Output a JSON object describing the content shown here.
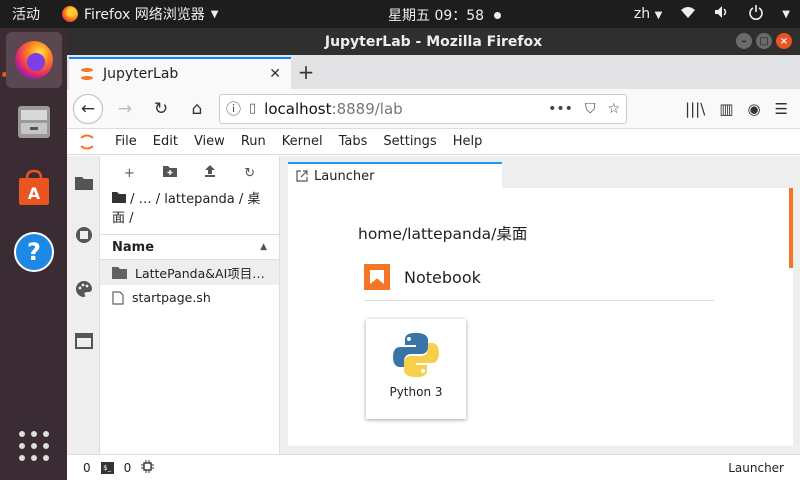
{
  "topbar": {
    "activities": "活动",
    "app_menu": "Firefox 网络浏览器",
    "clock": "星期五 09：58",
    "language": "zh"
  },
  "dock": {
    "items": [
      "firefox",
      "file-cabinet",
      "software-center",
      "help"
    ]
  },
  "window": {
    "title": "JupyterLab - Mozilla Firefox"
  },
  "browser": {
    "tab_title": "JupyterLab",
    "url_host": "localhost",
    "url_path": ":8889/lab"
  },
  "jupyter": {
    "menu": [
      "File",
      "Edit",
      "View",
      "Run",
      "Kernel",
      "Tabs",
      "Settings",
      "Help"
    ],
    "breadcrumbs": "/ … / lattepanda / 桌面 /",
    "file_header": "Name",
    "files": [
      {
        "name": "LattePanda&AI项目…",
        "type": "folder"
      },
      {
        "name": "startpage.sh",
        "type": "file"
      }
    ],
    "doc_tab": "Launcher",
    "launcher": {
      "cwd": "home/lattepanda/桌面",
      "section": "Notebook",
      "kernel_card": "Python 3"
    },
    "status": {
      "kernels": "0",
      "terminals": "0",
      "right": "Launcher"
    }
  },
  "colors": {
    "accent_ubuntu": "#e95420",
    "jupyter_orange": "#f37626",
    "firefox_blue": "#0a84ff"
  }
}
